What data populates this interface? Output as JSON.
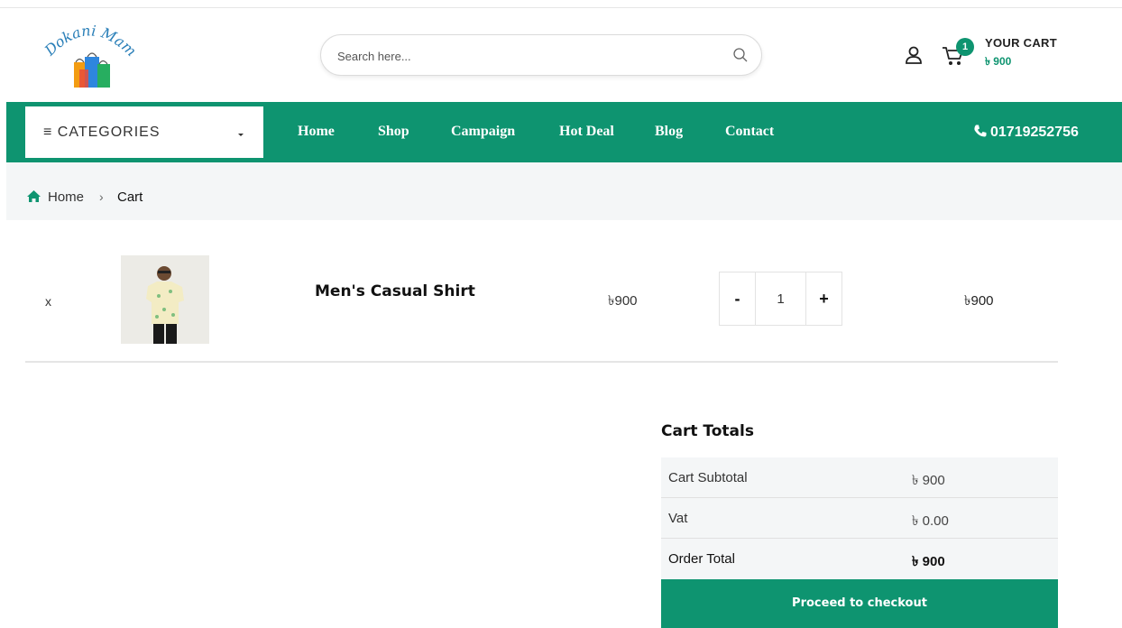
{
  "logo": {
    "text": "Dokani Mama"
  },
  "search": {
    "placeholder": "Search here..."
  },
  "header": {
    "cart_count": "1",
    "cart_label": "YOUR CART",
    "cart_amount": "৳ 900"
  },
  "nav": {
    "categories_label": "≡ CATEGORIES",
    "items": [
      "Home",
      "Shop",
      "Campaign",
      "Hot Deal",
      "Blog",
      "Contact"
    ],
    "phone": "01719252756"
  },
  "breadcrumb": {
    "home": "Home",
    "separator": "›",
    "current": "Cart"
  },
  "cart": {
    "items": [
      {
        "remove": "x",
        "name": "Men's Casual Shirt",
        "price": "৳900",
        "quantity": "1",
        "total": "৳900"
      }
    ],
    "qty_minus": "-",
    "qty_plus": "+"
  },
  "totals": {
    "title": "Cart Totals",
    "rows": [
      {
        "label": "Cart Subtotal",
        "value": "৳ 900"
      },
      {
        "label": "Vat",
        "value": "৳ 0.00"
      },
      {
        "label": "Order Total",
        "value": "৳ 900"
      }
    ],
    "checkout_label": "Proceed to checkout"
  },
  "colors": {
    "brand": "#0e9470",
    "breadcrumb_bg": "#f4f6f7"
  },
  "icons": [
    "search-icon",
    "user-icon",
    "cart-icon",
    "chevron-down-icon",
    "phone-icon",
    "home-icon"
  ]
}
